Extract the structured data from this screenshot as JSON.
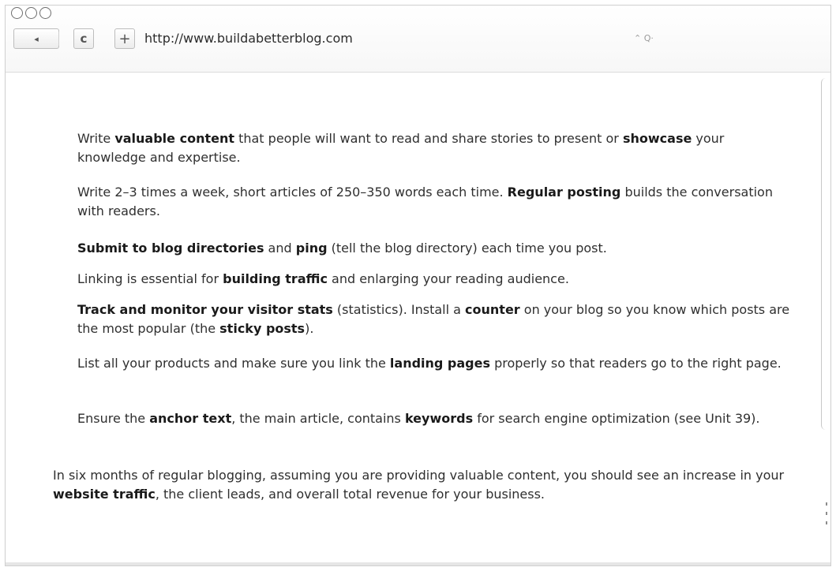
{
  "browser": {
    "url": "http://www.buildabetterblog.com",
    "back_glyph": "◂",
    "reload_glyph": "c",
    "add_glyph": "+",
    "search_glyph": "⌃ Q·"
  },
  "items": [
    [
      {
        "t": "Write "
      },
      {
        "b": "valuable content"
      },
      {
        "t": " that people will want to read and share stories to present or "
      },
      {
        "b": "showcase"
      },
      {
        "t": " your knowledge and expertise."
      }
    ],
    [
      {
        "t": "Write 2–3 times a week, short articles of 250–350 words each time. "
      },
      {
        "b": "Regular posting"
      },
      {
        "t": " builds the conversation with readers."
      }
    ],
    [
      {
        "b": "Submit to blog directories"
      },
      {
        "t": " and "
      },
      {
        "b": "ping"
      },
      {
        "t": " (tell the blog directory) each time you post."
      }
    ],
    [
      {
        "t": "Linking is essential for "
      },
      {
        "b": "building traffic"
      },
      {
        "t": " and enlarging your reading audience."
      }
    ],
    [
      {
        "b": "Track and monitor your visitor stats"
      },
      {
        "t": " (statistics). Install a "
      },
      {
        "b": "counter"
      },
      {
        "t": " on your blog so you know which posts are the most popular (the "
      },
      {
        "b": "sticky posts"
      },
      {
        "t": ")."
      }
    ],
    [
      {
        "t": "List all your products and make sure you link the "
      },
      {
        "b": "landing pages"
      },
      {
        "t": " properly so that readers go to the right page."
      }
    ],
    [
      {
        "t": "Ensure the "
      },
      {
        "b": "anchor text"
      },
      {
        "t": ", the main article, contains "
      },
      {
        "b": "keywords"
      },
      {
        "t": " for search engine optimization (see Unit 39)."
      }
    ]
  ],
  "closing": [
    {
      "t": "In six months of regular blogging, assuming you are providing valuable content, you should see an increase in your "
    },
    {
      "b": "website traffic"
    },
    {
      "t": ", the client leads, and overall total revenue for your business."
    }
  ]
}
